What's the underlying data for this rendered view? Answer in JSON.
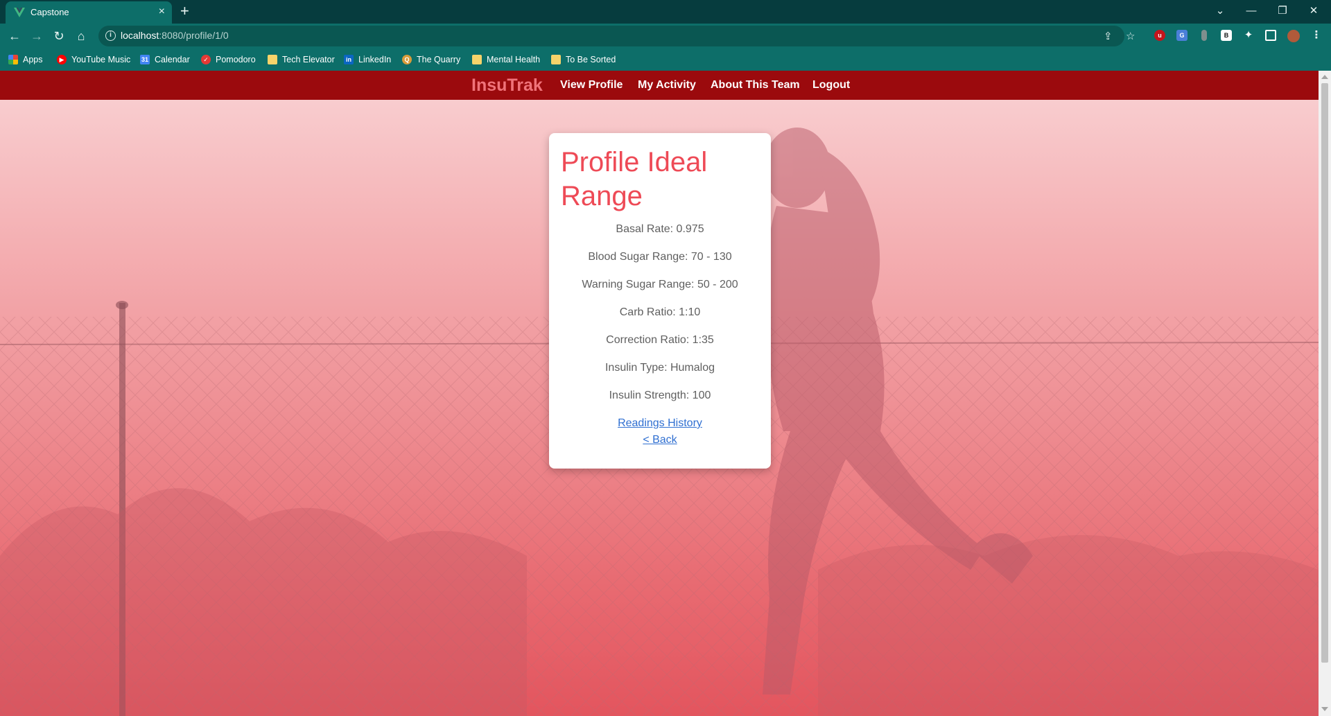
{
  "browser": {
    "tab_title": "Capstone",
    "tab_close": "×",
    "new_tab": "+",
    "url_host": "localhost",
    "url_rest": ":8080/profile/1/0",
    "icons": [
      "back-arrow-icon",
      "forward-arrow-icon",
      "reload-icon",
      "home-icon",
      "info-icon",
      "share-icon",
      "star-icon",
      "ublock-icon",
      "translate-icon",
      "extension-icon",
      "puzzle-icon",
      "sidepanel-icon",
      "profile-avatar-icon",
      "menu-kebab-icon"
    ]
  },
  "bookmarks": [
    {
      "label": "Apps",
      "icon": "apps-grid-icon"
    },
    {
      "label": "YouTube Music",
      "icon": "youtube-music-icon"
    },
    {
      "label": "Calendar",
      "icon": "calendar-icon"
    },
    {
      "label": "Pomodoro",
      "icon": "pomodoro-icon"
    },
    {
      "label": "Tech Elevator",
      "icon": "folder-icon"
    },
    {
      "label": "LinkedIn",
      "icon": "linkedin-icon"
    },
    {
      "label": "The Quarry",
      "icon": "quarry-icon"
    },
    {
      "label": "Mental Health",
      "icon": "folder-icon"
    },
    {
      "label": "To Be Sorted",
      "icon": "folder-icon"
    }
  ],
  "nav": {
    "brand": "InsuTrak",
    "links": [
      "View Profile",
      "My Activity",
      "About This Team",
      "Logout"
    ]
  },
  "card": {
    "title": "Profile Ideal Range",
    "fields": [
      "Basal Rate: 0.975",
      "Blood Sugar Range: 70 - 130",
      "Warning Sugar Range: 50 - 200",
      "Carb Ratio: 1:10",
      "Correction Ratio: 1:35",
      "Insulin Type: Humalog",
      "Insulin Strength: 100"
    ],
    "links": [
      "Readings History",
      "< Back"
    ]
  },
  "colors": {
    "navbar": "#9b0a0d",
    "brand": "#f0737a",
    "title": "#ee4a56",
    "link": "#2f6fd1",
    "browser_frame": "#0d6e69"
  }
}
